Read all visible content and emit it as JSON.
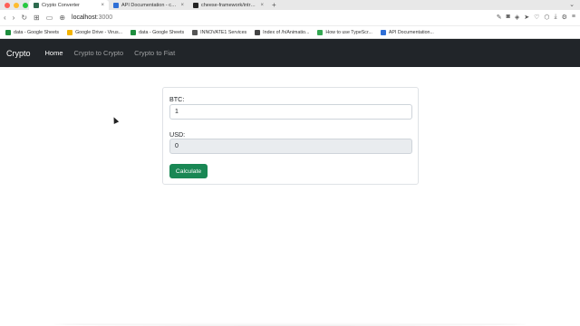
{
  "browser": {
    "tabs": [
      {
        "title": "Crypto Converter",
        "active": true,
        "color": "#2e6b4f"
      },
      {
        "title": "API Documentation - coinlayer",
        "active": false,
        "color": "#2f6fd6"
      },
      {
        "title": "cheese-framework/intro-react",
        "active": false,
        "color": "#222222"
      }
    ],
    "address": "localhost",
    "port": ":3000",
    "bookmarks": [
      {
        "label": "data - Google Sheets",
        "color": "#1e8e3e"
      },
      {
        "label": "Google Drive - Virus...",
        "color": "#f4b400"
      },
      {
        "label": "data - Google Sheets",
        "color": "#1e8e3e"
      },
      {
        "label": "INNOVATE1 Services",
        "color": "#555555"
      },
      {
        "label": "Index of /h/Animatio...",
        "color": "#444444"
      },
      {
        "label": "How to use TypeScr...",
        "color": "#34a853"
      },
      {
        "label": "API Documentation...",
        "color": "#2f6fd6"
      }
    ]
  },
  "nav": {
    "brand": "Crypto",
    "links": [
      "Home",
      "Crypto to Crypto",
      "Crypto to Fiat"
    ],
    "background": "#212529"
  },
  "form": {
    "btc_label": "BTC:",
    "btc_value": "1",
    "usd_label": "USD:",
    "usd_value": "0",
    "button_label": "Calculate",
    "button_color": "#198754"
  }
}
